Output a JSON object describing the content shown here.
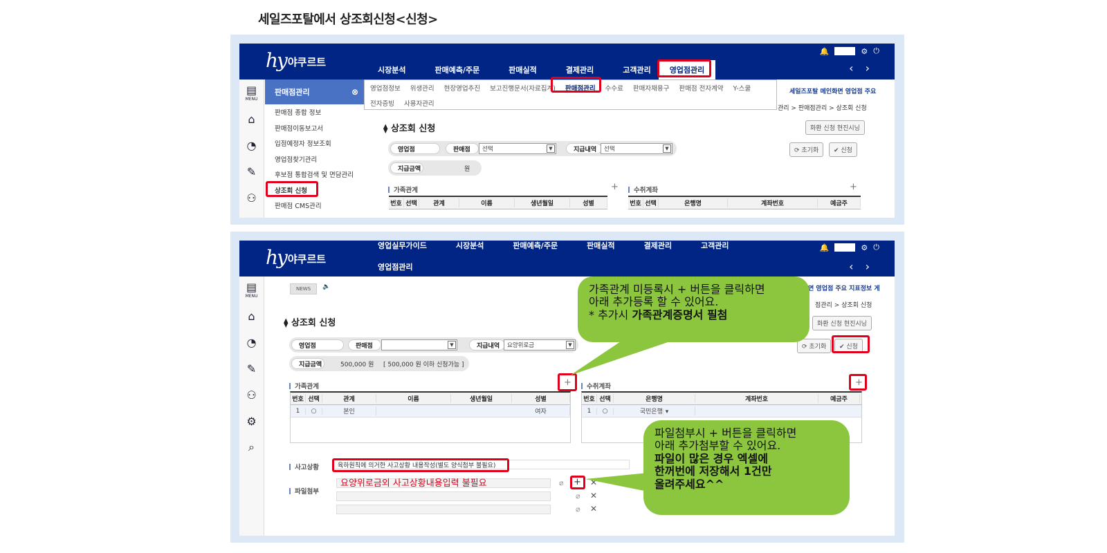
{
  "doc_title": "세일즈포탈에서 상조회신청<신청>",
  "brand": {
    "hy": "hy",
    "name": "야쿠르트"
  },
  "top_icons": {
    "bell": "🔔",
    "gear": "⚙",
    "power": "⏻",
    "arrows": "‹ ›"
  },
  "nav1": [
    "시장분석",
    "판매예측/주문",
    "판매실적",
    "결제관리",
    "고객관리"
  ],
  "nav1_active": "영업점관리",
  "nav2_row1": [
    "영업실무가이드",
    "시장분석",
    "판매예측/주문",
    "판매실적",
    "결제관리",
    "고객관리"
  ],
  "nav2_row2": "영업점관리",
  "rail": {
    "menu": "MENU",
    "my": "MY"
  },
  "sidepanel": {
    "title": "판매점관리",
    "items": [
      "판매점 종합 정보",
      "판매점이동보고서",
      "입점예정자 정보조회",
      "영업점찾기관리",
      "후보점 통합검색 및 면담관리",
      "상조회 신청",
      "판매점 CMS관리"
    ]
  },
  "submenu": {
    "row1": [
      "영업점정보",
      "위생관리",
      "현장영업추진",
      "보고진행문서(자료집계)",
      "판매점관리",
      "수수료",
      "판매자채용구",
      "판매점 전자계약",
      "Y-스쿨"
    ],
    "row2": [
      "전자증빙",
      "사용자관리"
    ]
  },
  "right_banner1": "세일즈포탈 메인화면 영업점 주요",
  "right_banner2": "면 영업점 주요 지표정보 게",
  "breadcrumb1": "관리 > 판매점관리 > 상조회 신청",
  "breadcrumb2": "점관리 > 상조회 신청",
  "page_title": "상조회 신청",
  "btn_screen": "화환 신청 현진시닝",
  "filters": {
    "branch": "영업점",
    "store": "판매점",
    "store_value1": "선택",
    "store_value2": "",
    "pay": "지급내역",
    "pay_value1": "선택",
    "pay_value2": "요양위로금",
    "reset": "초기화",
    "apply": "신청"
  },
  "amount": {
    "label": "지급금액",
    "value1": "원",
    "value2": "500,000 원",
    "limit": "[ 500,000 원 이하 신청가능 ]"
  },
  "family": {
    "title": "가족관계",
    "headers": [
      "번호",
      "선택",
      "관계",
      "이름",
      "생년월일",
      "성별"
    ],
    "row": [
      "1",
      "○",
      "본인",
      "",
      "",
      "여자"
    ]
  },
  "account": {
    "title": "수취계좌",
    "headers1": [
      "번호",
      "선택",
      "은행명",
      "계좌번호",
      "예금주"
    ],
    "row": [
      "1",
      "○",
      "국민은행",
      "",
      ""
    ]
  },
  "accident": {
    "title": "사고상황",
    "value": "육하원칙에 의거한 사고상황 내용작성(별도 양식첨부 불필요)"
  },
  "attach": {
    "title": "파일첨부"
  },
  "news": "NEWS",
  "red_note": "요양위로금외 사고상황내용입력 불필요",
  "callout1": {
    "line1": "가족관계 미등록시 + 버튼을 클릭하면",
    "line2": "아래 추가등록 할 수 있어요.",
    "line3_pre": "* 추가시 ",
    "line3_bold": "가족관계증명서 필첨"
  },
  "callout2": {
    "line1": "파일첨부시 + 버튼을 클릭하면",
    "line2": "아래 추가첨부할 수 있어요.",
    "line3": "파일이 많은 경우 엑셀에",
    "line4": "한꺼번에 저장해서 1건만",
    "line5": "올려주세요^^"
  },
  "colors": {
    "navy": "#002585",
    "red": "#e0001b",
    "green": "#8cc63f",
    "frame": "#dce8f5"
  }
}
